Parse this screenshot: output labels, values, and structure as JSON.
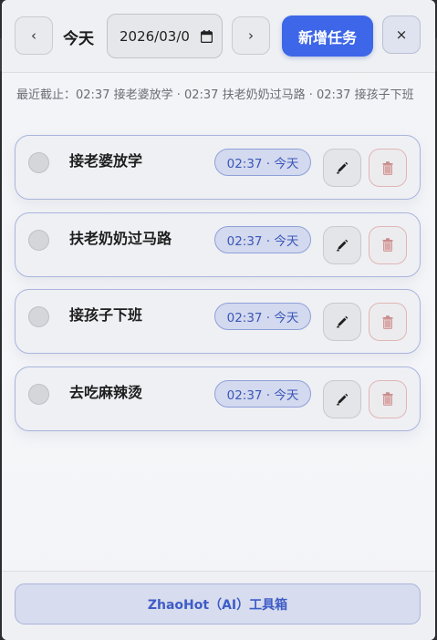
{
  "header": {
    "prev_label": "‹",
    "today_label": "今天",
    "date_value": "2026/03/0",
    "next_label": "›",
    "add_label": "新增任务",
    "close_label": "×"
  },
  "recent": {
    "text": "最近截止：02:37 接老婆放学 · 02:37 扶老奶奶过马路 · 02:37 接孩子下班"
  },
  "tasks": [
    {
      "title": "接老婆放学",
      "time": "02:37 · 今天"
    },
    {
      "title": "扶老奶奶过马路",
      "time": "02:37 · 今天"
    },
    {
      "title": "接孩子下班",
      "time": "02:37 · 今天"
    },
    {
      "title": "去吃麻辣烫",
      "time": "02:37 · 今天"
    }
  ],
  "footer": {
    "toolbox_label": "ZhaoHot（AI）工具箱"
  },
  "icons": {
    "edit": "pencil-icon",
    "delete": "trash-icon",
    "calendar": "calendar-icon"
  },
  "colors": {
    "accent": "#3d66e8",
    "badge_text": "#3b57b9",
    "badge_bg": "#d3d9ee",
    "card_border": "#aab4dc",
    "delete_border": "#e0b5b5"
  }
}
